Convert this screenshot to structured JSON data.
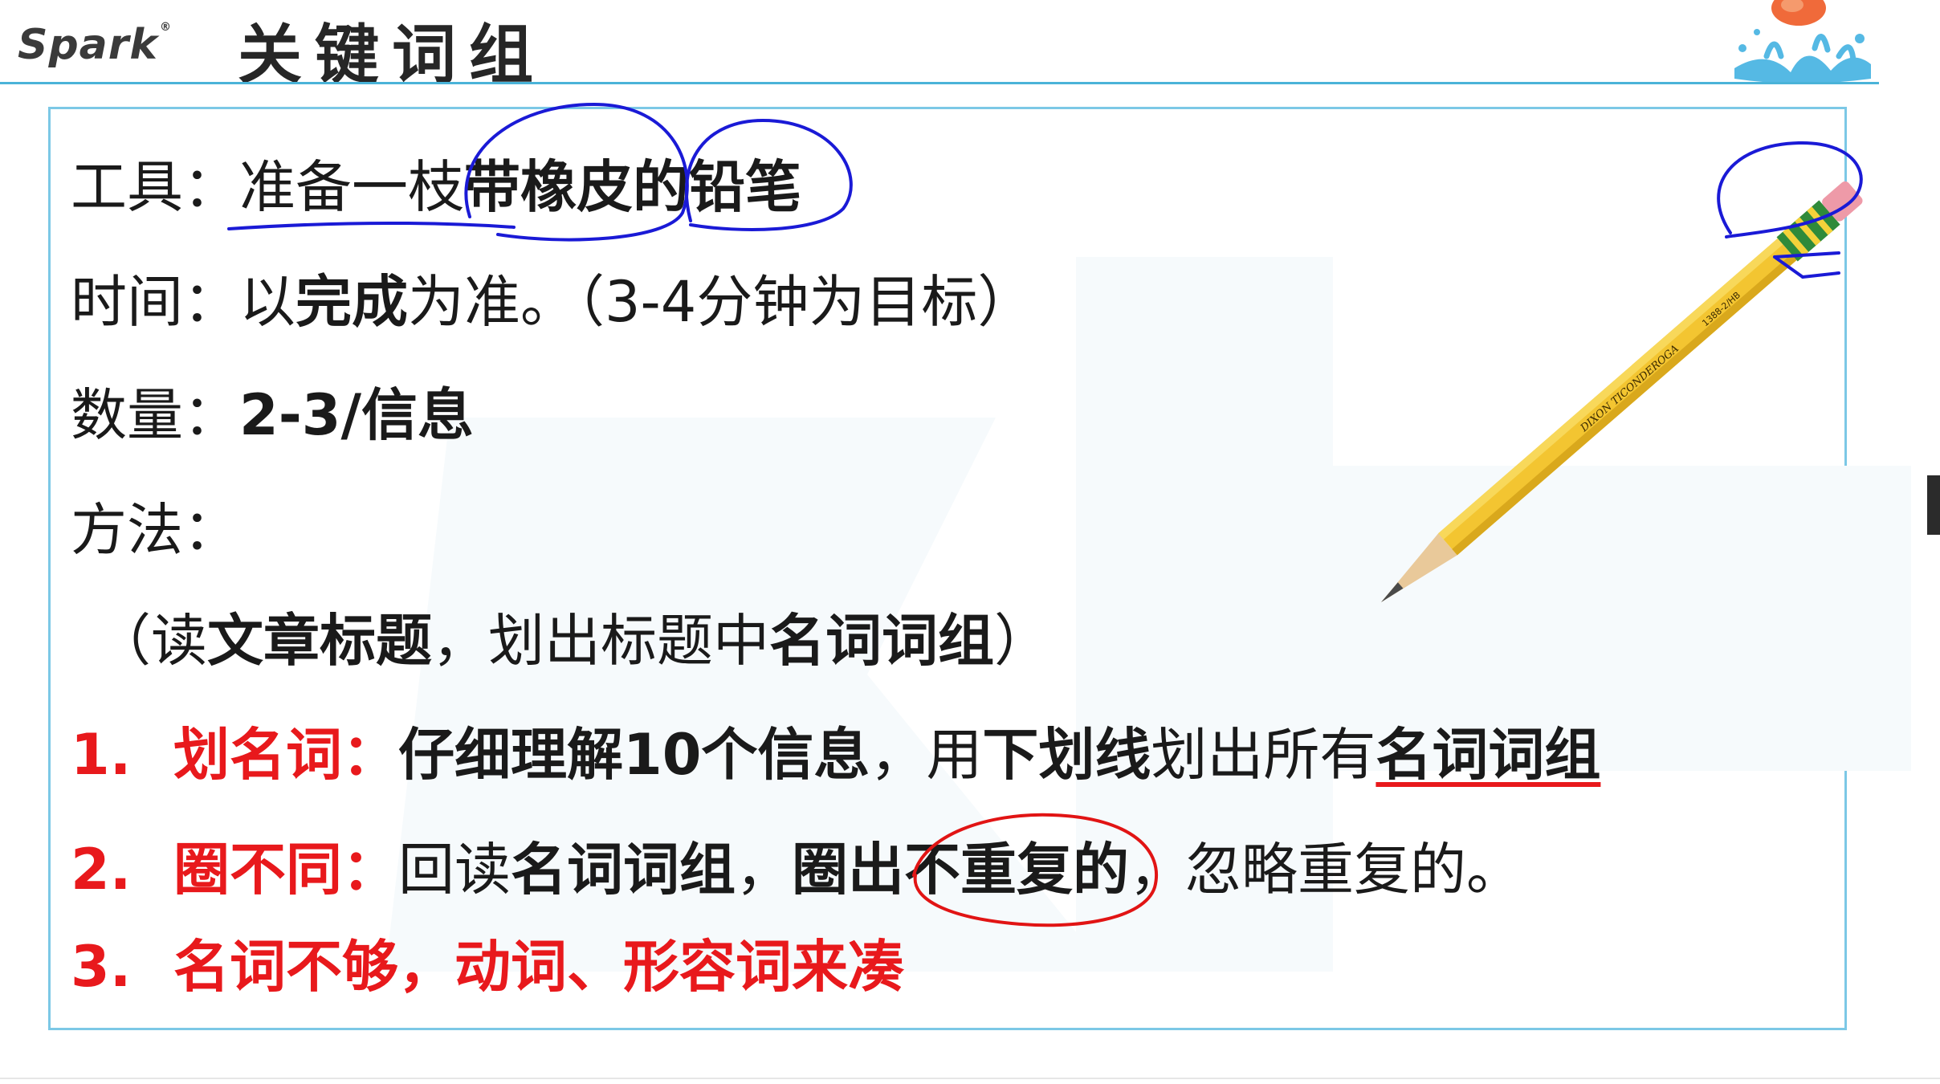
{
  "header": {
    "logo": "Spark",
    "logo_mark": "®",
    "title": "关键词组"
  },
  "lines": {
    "tool": {
      "label": "工具：",
      "plain": "准备一枝",
      "bold": "带橡皮的铅笔"
    },
    "time": {
      "label": "时间：",
      "t1": "以",
      "t2": "完成",
      "t3": "为准。（3-4分钟为目标）"
    },
    "quantity": {
      "label": "数量：",
      "value": "2-3/信息"
    },
    "method": {
      "label": "方法："
    },
    "method_detail": {
      "t1": "（读",
      "t2": "文章标题",
      "t3": "，划出标题中",
      "t4": "名词词组",
      "t5": "）"
    }
  },
  "steps": [
    {
      "num": "1.",
      "label": "划名词：",
      "s1": "仔细理解10个信息",
      "s2": "，用",
      "s3": "下划线",
      "s4": "划出所有",
      "s5": "名词词组"
    },
    {
      "num": "2.",
      "label": "圈不同：",
      "s1": "回读",
      "s2": "名词词组",
      "s3": "，",
      "s4": "圈出",
      "s5": "不重复的",
      "s6": "，忽略重复的。"
    },
    {
      "num": "3.",
      "label": "名词不够，动词、形容词来凑"
    }
  ],
  "pencil": {
    "brand_text": "DIXON TICONDEROGA",
    "model_text": "1388-2/HB"
  },
  "colors": {
    "accent_line": "#4ab3d8",
    "box_border": "#7cc8e6",
    "step_red": "#e8191c",
    "pen_blue": "#1a1ad6",
    "pen_red": "#e11414",
    "pencil_yellow": "#f3c531"
  }
}
